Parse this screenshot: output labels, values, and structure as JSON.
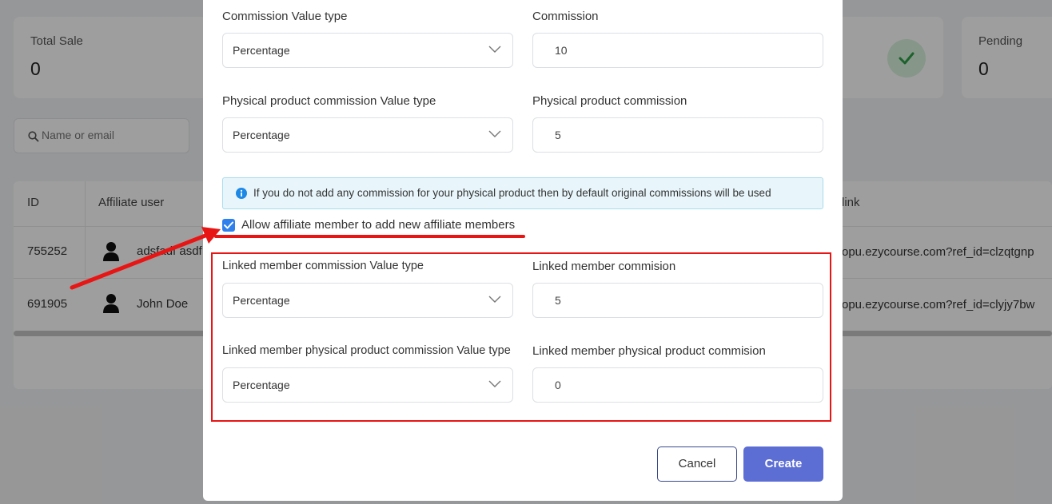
{
  "stats": {
    "total_sale_label": "Total Sale",
    "total_sale_value": "0",
    "pending_label": "Pending",
    "pending_value": "0"
  },
  "search": {
    "placeholder": "Name or email"
  },
  "table": {
    "headers": [
      "ID",
      "Affiliate user",
      "link"
    ],
    "rows": [
      {
        "id": "755252",
        "name": "adsfadf asdf",
        "link": "opu.ezycourse.com?ref_id=clzqtgnp"
      },
      {
        "id": "691905",
        "name": "John Doe",
        "link": "opu.ezycourse.com?ref_id=clyjy7bw"
      }
    ]
  },
  "modal": {
    "commission_value_type_label": "Commission Value type",
    "commission_value_type": "Percentage",
    "commission_label": "Commission",
    "commission_value": "10",
    "physical_value_type_label": "Physical product commission Value type",
    "physical_value_type": "Percentage",
    "physical_commission_label": "Physical product commission",
    "physical_commission_value": "5",
    "info_text": "If you do not add any commission for your physical product then by default original commissions will be used",
    "allow_label": "Allow affiliate member to add new affiliate members",
    "allow_checked": true,
    "linked_value_type_label": "Linked member commission Value type",
    "linked_value_type": "Percentage",
    "linked_commission_label": "Linked member commision",
    "linked_commission_value": "5",
    "linked_physical_value_type_label": "Linked member physical product commission Value type",
    "linked_physical_value_type": "Percentage",
    "linked_physical_commission_label": "Linked member physical product commision",
    "linked_physical_commission_value": "0",
    "cancel_label": "Cancel",
    "create_label": "Create"
  },
  "colors": {
    "primary": "#5c6dd3",
    "annotation_red": "#e81515",
    "checkbox_blue": "#2f80ed"
  }
}
